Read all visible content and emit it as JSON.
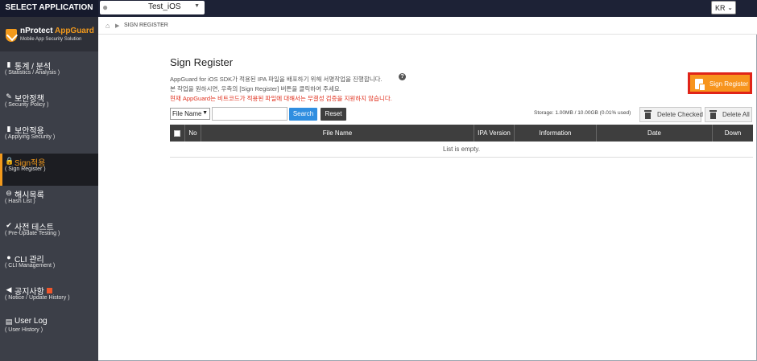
{
  "topbar": {
    "select_application": "SELECT APPLICATION",
    "app_selector": {
      "value": "Test_iOS",
      "icon": "apple-icon"
    },
    "language": "KR"
  },
  "brand": {
    "name_part1": "nProtect",
    "name_part2": "AppGuard",
    "subtitle": "Mobile App Security Solution",
    "accent": "#f39a1c"
  },
  "sidebar": {
    "items": [
      {
        "label": "통계 / 분석",
        "sub": "( Statistics / Analysis )",
        "icon": "bar-chart-icon"
      },
      {
        "label": "보안정책",
        "sub": "( Security Policy )",
        "icon": "wrench-icon"
      },
      {
        "label": "보안적용",
        "sub": "( Applying Security )",
        "icon": "file-icon"
      },
      {
        "label": "Sign적용",
        "sub": "( Sign Register )",
        "icon": "lock-icon",
        "active": true
      },
      {
        "label": "해시목록",
        "sub": "( Hash List )",
        "icon": "minus-circle-icon"
      },
      {
        "label": "사전 테스트",
        "sub": "( Pre-Update Testing )",
        "icon": "check-icon"
      },
      {
        "label": "CLI 관리",
        "sub": "( CLI Management )",
        "icon": "circle-icon"
      },
      {
        "label": "공지사항",
        "sub": "( Notice / Update History )",
        "icon": "megaphone-icon",
        "badge": "new-badge"
      },
      {
        "label": "User Log",
        "sub": "( User History )",
        "icon": "list-icon"
      }
    ]
  },
  "breadcrumb": {
    "home_icon": "home-icon",
    "current": "SIGN REGISTER"
  },
  "main": {
    "title": "Sign Register",
    "desc_line1": "AppGuard for iOS SDK가 적용된 IPA 파일을 배포하기 위해 서명작업을 진행합니다.",
    "desc_line2": "본 작업을 원하시면, 우측의 [Sign Register] 버튼을 클릭하여 주세요.",
    "desc_warning": "현재 AppGuard는 비트코드가 적용된 파일에 대해서는 무결성 검증을 지원하지 않습니다.",
    "sign_register_button": "Sign Register",
    "filter_select": "File Name",
    "search_input": "",
    "search_button": "Search",
    "reset_button": "Reset",
    "storage": "Storage: 1.00MB / 10.00GB (0.01% used)",
    "delete_checked_button": "Delete Checked",
    "delete_all_button": "Delete All",
    "table": {
      "columns": [
        "No",
        "File Name",
        "IPA Version",
        "Information",
        "Date",
        "Down"
      ],
      "empty_message": "List is empty."
    }
  },
  "colors": {
    "orange": "#f7941d",
    "highlight_border": "#e02418",
    "search_blue": "#2f8ee0",
    "warning_red": "#e0301e"
  }
}
